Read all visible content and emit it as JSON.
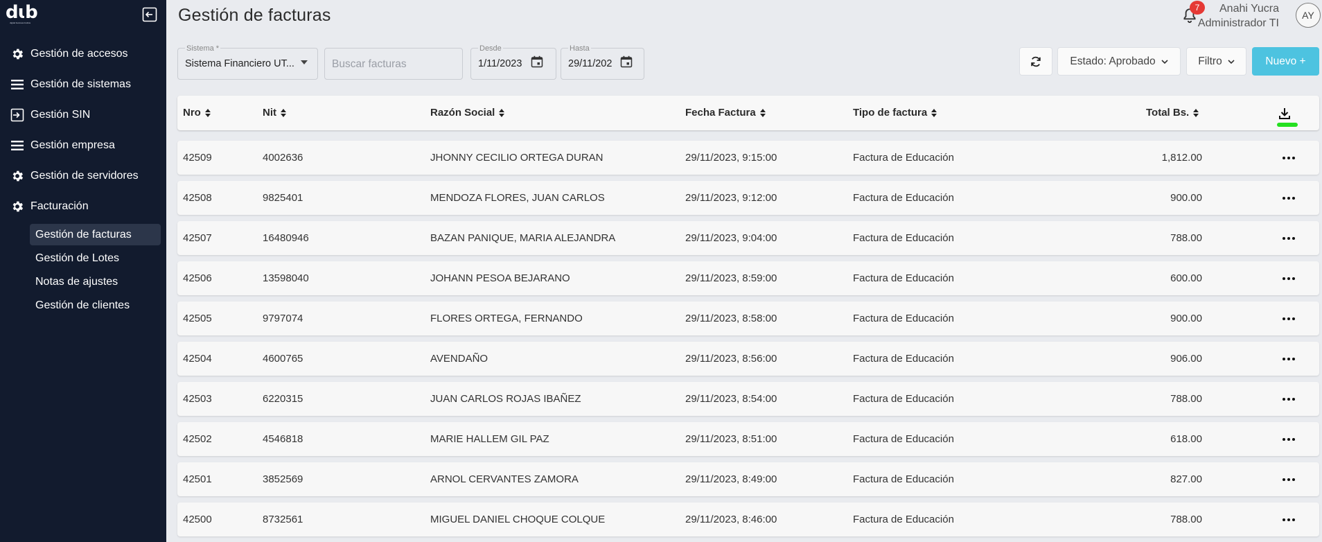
{
  "app": {
    "logo_text": "dɩb",
    "logo_sub": "digital business bolivia"
  },
  "sidebar": {
    "items": [
      {
        "label": "Gestión de accesos",
        "icon": "gear-icon"
      },
      {
        "label": "Gestión de sistemas",
        "icon": "menu-icon"
      },
      {
        "label": "Gestión SIN",
        "icon": "login-icon"
      },
      {
        "label": "Gestión empresa",
        "icon": "menu-icon"
      },
      {
        "label": "Gestión de servidores",
        "icon": "gear-icon"
      },
      {
        "label": "Facturación",
        "icon": "gear-icon"
      }
    ],
    "sub_items": [
      {
        "label": "Gestión de facturas",
        "active": true
      },
      {
        "label": "Gestión de Lotes",
        "active": false
      },
      {
        "label": "Notas de ajustes",
        "active": false
      },
      {
        "label": "Gestión de clientes",
        "active": false
      }
    ]
  },
  "header": {
    "title": "Gestión de facturas",
    "notifications_count": "7",
    "user_name": "Anahi Yucra",
    "user_role": "Administrador TI",
    "avatar_initials": "AY"
  },
  "toolbar": {
    "sistema_label": "Sistema *",
    "sistema_value": "Sistema Financiero UT...",
    "search_placeholder": "Buscar facturas",
    "desde_label": "Desde",
    "desde_value": "1/11/2023",
    "hasta_label": "Hasta",
    "hasta_value": "29/11/202",
    "estado_label": "Estado: Aprobado",
    "filtro_label": "Filtro",
    "nuevo_label": "Nuevo  +"
  },
  "table": {
    "columns": {
      "nro": "Nro",
      "nit": "Nit",
      "razon": "Razón Social",
      "fecha": "Fecha Factura",
      "tipo": "Tipo de factura",
      "total": "Total Bs."
    },
    "rows": [
      {
        "nro": "42509",
        "nit": "4002636",
        "razon": "JHONNY CECILIO ORTEGA DURAN",
        "fecha": "29/11/2023, 9:15:00",
        "tipo": "Factura de Educación",
        "total": "1,812.00"
      },
      {
        "nro": "42508",
        "nit": "9825401",
        "razon": "MENDOZA FLORES, JUAN CARLOS",
        "fecha": "29/11/2023, 9:12:00",
        "tipo": "Factura de Educación",
        "total": "900.00"
      },
      {
        "nro": "42507",
        "nit": "16480946",
        "razon": "BAZAN PANIQUE, MARIA ALEJANDRA",
        "fecha": "29/11/2023, 9:04:00",
        "tipo": "Factura de Educación",
        "total": "788.00"
      },
      {
        "nro": "42506",
        "nit": "13598040",
        "razon": "JOHANN PESOA BEJARANO",
        "fecha": "29/11/2023, 8:59:00",
        "tipo": "Factura de Educación",
        "total": "600.00"
      },
      {
        "nro": "42505",
        "nit": "9797074",
        "razon": "FLORES ORTEGA, FERNANDO",
        "fecha": "29/11/2023, 8:58:00",
        "tipo": "Factura de Educación",
        "total": "900.00"
      },
      {
        "nro": "42504",
        "nit": "4600765",
        "razon": "AVENDAÑO",
        "fecha": "29/11/2023, 8:56:00",
        "tipo": "Factura de Educación",
        "total": "906.00"
      },
      {
        "nro": "42503",
        "nit": "6220315",
        "razon": "JUAN CARLOS ROJAS IBAÑEZ",
        "fecha": "29/11/2023, 8:54:00",
        "tipo": "Factura de Educación",
        "total": "788.00"
      },
      {
        "nro": "42502",
        "nit": "4546818",
        "razon": "MARIE HALLEM GIL PAZ",
        "fecha": "29/11/2023, 8:51:00",
        "tipo": "Factura de Educación",
        "total": "618.00"
      },
      {
        "nro": "42501",
        "nit": "3852569",
        "razon": "ARNOL CERVANTES ZAMORA",
        "fecha": "29/11/2023, 8:49:00",
        "tipo": "Factura de Educación",
        "total": "827.00"
      },
      {
        "nro": "42500",
        "nit": "8732561",
        "razon": "MIGUEL DANIEL CHOQUE COLQUE",
        "fecha": "29/11/2023, 8:46:00",
        "tipo": "Factura de Educación",
        "total": "788.00"
      }
    ]
  },
  "colors": {
    "sidebar_bg": "#121b2e",
    "page_bg": "#e9ebef",
    "accent": "#4dc3e0",
    "badge": "#e53935",
    "highlight_mark": "#25e020"
  }
}
